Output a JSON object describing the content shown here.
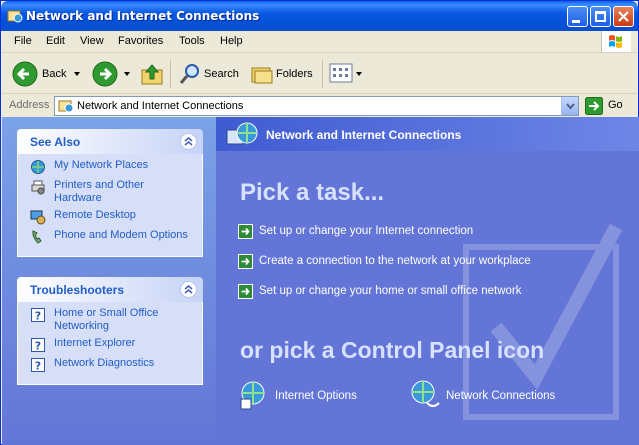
{
  "window": {
    "title": "Network and Internet Connections"
  },
  "menubar": {
    "items": [
      "File",
      "Edit",
      "View",
      "Favorites",
      "Tools",
      "Help"
    ]
  },
  "toolbar": {
    "back_label": "Back",
    "search_label": "Search",
    "folders_label": "Folders"
  },
  "addressbar": {
    "label": "Address",
    "value": "Network and Internet Connections",
    "go_label": "Go"
  },
  "sidepane": {
    "see_also": {
      "title": "See Also",
      "items": [
        {
          "line1": "My Network Places",
          "line2": "",
          "icon": "network-places-icon"
        },
        {
          "line1": "Printers and Other",
          "line2": "Hardware",
          "icon": "printer-icon"
        },
        {
          "line1": "Remote Desktop",
          "line2": "",
          "icon": "remote-desktop-icon"
        },
        {
          "line1": "Phone and Modem Options",
          "line2": "",
          "icon": "phone-icon"
        }
      ]
    },
    "troubleshooters": {
      "title": "Troubleshooters",
      "items": [
        {
          "line1": "Home or Small Office",
          "line2": "Networking",
          "icon": "help-icon"
        },
        {
          "line1": "Internet Explorer",
          "line2": "",
          "icon": "help-icon"
        },
        {
          "line1": "Network Diagnostics",
          "line2": "",
          "icon": "help-icon"
        }
      ]
    }
  },
  "main": {
    "banner_title": "Network and Internet Connections",
    "pick_task_heading": "Pick a task...",
    "tasks": [
      "Set up or change your Internet connection",
      "Create a connection to the network at your workplace",
      "Set up or change your home or small office network"
    ],
    "pick_icon_heading": "or pick a Control Panel icon",
    "icons": [
      {
        "label": "Internet Options",
        "icon": "internet-options-icon"
      },
      {
        "label": "Network Connections",
        "icon": "network-connections-icon"
      }
    ]
  },
  "colors": {
    "titlebar": "#0a58e4",
    "content_bg": "#6375d6",
    "link": "#215dc6",
    "task_arrow": "#2e8b38"
  }
}
